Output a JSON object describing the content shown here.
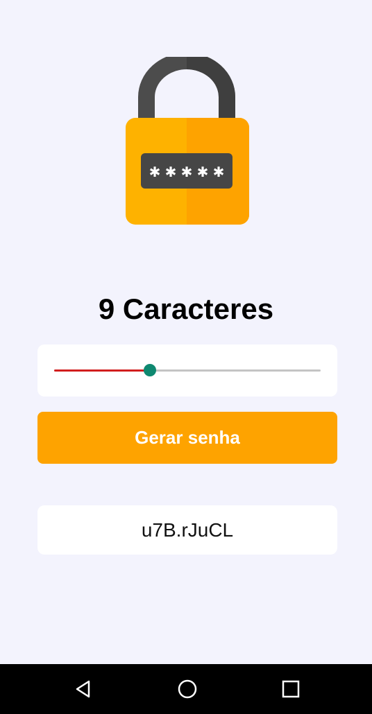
{
  "header": {
    "lock_icon": "lock-icon"
  },
  "length": {
    "value": 9,
    "title": "9 Caracteres"
  },
  "slider": {
    "value_fraction": 0.36
  },
  "actions": {
    "generate_label": "Gerar senha"
  },
  "result": {
    "password": "u7B.rJuCL"
  },
  "colors": {
    "background": "#f3f3fd",
    "accent": "#fea300",
    "slider_active": "#d21e1e",
    "slider_thumb": "#0e8870",
    "slider_inactive": "#c4c4c4"
  },
  "navbar": {
    "icons": [
      "back-icon",
      "home-icon",
      "recents-icon"
    ]
  }
}
